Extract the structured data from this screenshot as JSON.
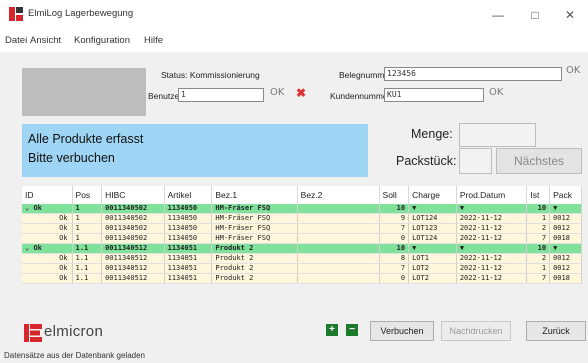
{
  "window": {
    "title": "ElmiLog Lagerbewegung",
    "minimize": "—",
    "maximize": "□",
    "close": "✕"
  },
  "menu": [
    "Datei",
    "Ansicht",
    "Konfiguration",
    "Hilfe"
  ],
  "header": {
    "status_label": "Status: Kommissionierung",
    "benutzer_label": "Benutzer:",
    "benutzer_value": "1",
    "belegnummer_label": "Belegnummer:",
    "belegnummer_value": "123456",
    "kundennummer_label": "Kundennummer:",
    "kundennummer_value": "KU1",
    "ok_label": "OK",
    "cancel_mark": "✖"
  },
  "message": {
    "line1": "Alle Produkte erfasst",
    "line2": "Bitte verbuchen"
  },
  "entry": {
    "menge_label": "Menge:",
    "packstueck_label": "Packstück:",
    "next_label": "Nächstes"
  },
  "table": {
    "columns": [
      "ID",
      "Pos",
      "HIBC",
      "Artikel",
      "Bez.1",
      "Bez.2",
      "Soll",
      "Charge",
      "Prod.Datum",
      "Ist",
      "Pack"
    ],
    "rows": [
      {
        "type": "group",
        "cells": [
          "Ok",
          "1",
          "0011340502",
          "1134050",
          "HM-Fräser FSQ",
          "",
          "10",
          "▼",
          "▼",
          "10",
          "▼"
        ]
      },
      {
        "type": "child",
        "cells": [
          "Ok",
          "1",
          "0011340502",
          "1134050",
          "HM-Fräser FSQ",
          "",
          "9",
          "LOT124",
          "2022-11-12",
          "1",
          "0012"
        ]
      },
      {
        "type": "child",
        "cells": [
          "Ok",
          "1",
          "0011340502",
          "1134050",
          "HM-Fräser FSQ",
          "",
          "7",
          "LOT123",
          "2022-11-12",
          "2",
          "0012"
        ]
      },
      {
        "type": "child",
        "cells": [
          "Ok",
          "1",
          "0011340502",
          "1134050",
          "HM-Fräser FSQ",
          "",
          "0",
          "LOT124",
          "2022-11-12",
          "7",
          "0018"
        ]
      },
      {
        "type": "group",
        "cells": [
          "Ok",
          "1.1",
          "0011340512",
          "1134051",
          "Produkt 2",
          "",
          "10",
          "▼",
          "▼",
          "10",
          "▼"
        ]
      },
      {
        "type": "child",
        "cells": [
          "Ok",
          "1.1",
          "0011340512",
          "1134051",
          "Produkt 2",
          "",
          "8",
          "LOT1",
          "2022-11-12",
          "2",
          "0012"
        ]
      },
      {
        "type": "child",
        "cells": [
          "Ok",
          "1.1",
          "0011340512",
          "1134051",
          "Produkt 2",
          "",
          "7",
          "LOT2",
          "2022-11-12",
          "1",
          "0012"
        ]
      },
      {
        "type": "child",
        "cells": [
          "Ok",
          "1.1",
          "0011340512",
          "1134051",
          "Produkt 2",
          "",
          "0",
          "LOT2",
          "2022-11-12",
          "7",
          "0018"
        ]
      }
    ]
  },
  "footer": {
    "logo_text": "elmicron",
    "expand_label": "+",
    "collapse_label": "−",
    "verbuchen_label": "Verbuchen",
    "nachdrucken_label": "Nachdrucken",
    "zurueck_label": "Zurück",
    "status_text": "Datensätze aus der Datenbank geladen"
  },
  "colors": {
    "message_bg": "#9fd5f4",
    "group_row_bg": "#7fe19a",
    "child_row_bg": "#fff6dc",
    "accent_red": "#d7262c"
  }
}
